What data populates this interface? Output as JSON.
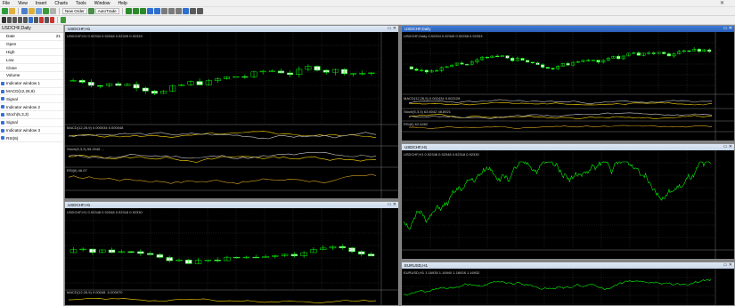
{
  "menu": {
    "items": [
      "File",
      "View",
      "Insert",
      "Charts",
      "Tools",
      "Window",
      "Help"
    ]
  },
  "toolbar": {
    "new_order_label": "New Order",
    "autotrade_label": "AutoTrade"
  },
  "data_window": {
    "title": "USDCHF,Daily",
    "rows": [
      {
        "label": "Date",
        "value": "21"
      },
      {
        "label": "Open",
        "value": ""
      },
      {
        "label": "High",
        "value": ""
      },
      {
        "label": "Low",
        "value": ""
      },
      {
        "label": "Close",
        "value": ""
      },
      {
        "label": "Volume",
        "value": ""
      }
    ],
    "indicators": [
      "Indicator window 1",
      "MACD(12,26,9)",
      "Signal",
      "Indicator window 2",
      "Stoch(5,3,3)",
      "Signal",
      "Indicator window 3",
      "RSI(6)"
    ]
  },
  "windows": {
    "w1": {
      "title": "USDCHF,H1",
      "info": "USDCHF,H1 0.92334 0.92348 0.92325 0.92333",
      "macd": "MACD(12,26,9) 0.000034 0.000048",
      "stoch": "Stoch(5,3,3) 55.2046 ...",
      "rsi": "RSI(6) 46.07"
    },
    "w2": {
      "title": "USDCHF,Daily",
      "info": "USDCHF,Daily 0.92334 0.92349 0.92258 0.92333",
      "macd": "MACD(12,26,9) 0.002434 0.002128",
      "stoch": "Stoch(5,3,3) 63.6042 48.8921",
      "rsi": "RSI(6) 62.6282"
    },
    "w3": {
      "title": "USDCHF,H1",
      "info": "USDCHF,H1 0.92348 0.92348 0.92318 0.92330",
      "macd": "MACD(12,26,9) 0.00048 -0.000070"
    },
    "w4": {
      "title": "USDCHF,H1",
      "info": "USDCHF,H1 0.92348 0.92348 0.92318 0.92330"
    },
    "w5": {
      "title": "EURUSD,H1",
      "info": "EURUSD,H1 1.16935 1.16940 1.16928 1.16932"
    }
  },
  "colors": {
    "bull": "#00ff00",
    "bear": "#ffffff",
    "line": "#00ff00",
    "grid": "#2e2e2e",
    "macd": "#c8c8c8",
    "signal": "#ffd700",
    "rsi": "#daa520"
  }
}
